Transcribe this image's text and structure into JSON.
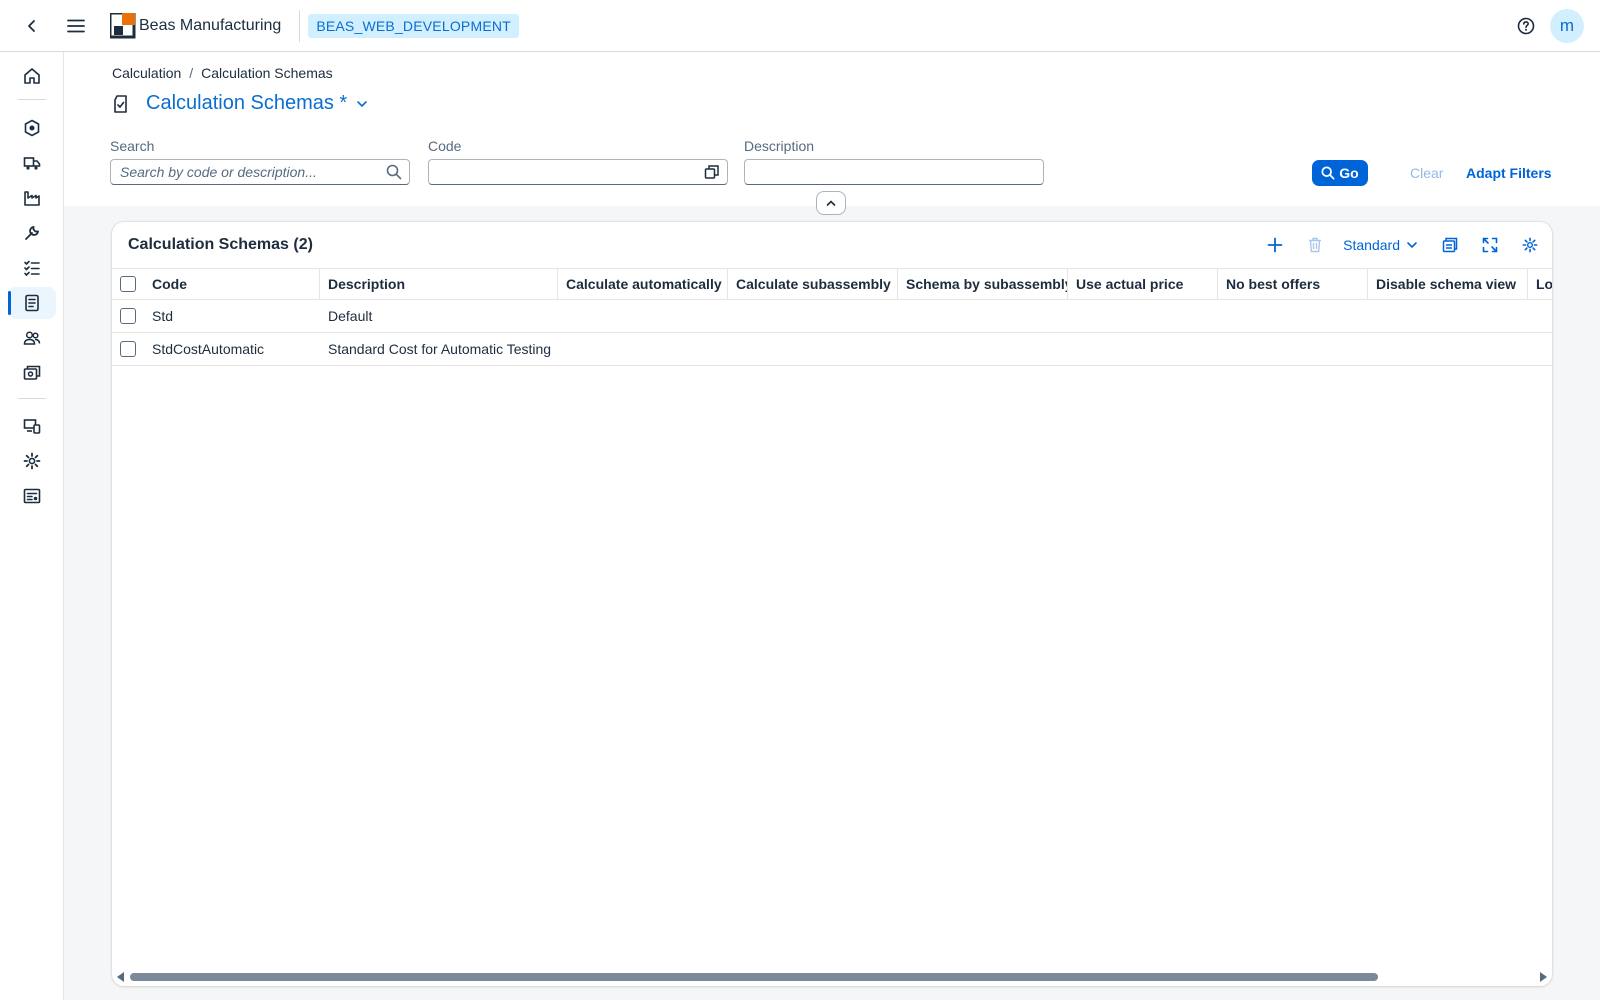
{
  "shell": {
    "app_name": "Beas Manufacturing",
    "system_badge": "BEAS_WEB_DEVELOPMENT",
    "avatar_initial": "m"
  },
  "sidebar": {
    "items": [
      {
        "icon": "home-icon",
        "active": false
      },
      {
        "icon": "products-icon",
        "active": false
      },
      {
        "icon": "delivery-truck-icon",
        "active": false
      },
      {
        "icon": "factory-icon",
        "active": false
      },
      {
        "icon": "wrench-icon",
        "active": false
      },
      {
        "icon": "checklist-icon",
        "active": false
      },
      {
        "icon": "calculation-sheet-icon",
        "active": true
      },
      {
        "icon": "people-icon",
        "active": false
      },
      {
        "icon": "money-cards-icon",
        "active": false
      },
      {
        "icon": "devices-icon",
        "active": false
      },
      {
        "icon": "settings-icon",
        "active": false
      },
      {
        "icon": "report-icon",
        "active": false
      }
    ]
  },
  "breadcrumb": {
    "items": [
      "Calculation",
      "Calculation Schemas"
    ],
    "separator": "/"
  },
  "page": {
    "title": "Calculation Schemas *"
  },
  "filters": {
    "search": {
      "label": "Search",
      "placeholder": "Search by code or description...",
      "value": ""
    },
    "code": {
      "label": "Code",
      "value": ""
    },
    "description": {
      "label": "Description",
      "value": ""
    },
    "go_label": "Go",
    "clear_label": "Clear",
    "adapt_label": "Adapt Filters"
  },
  "table": {
    "title": "Calculation Schemas (2)",
    "variant": "Standard",
    "columns": [
      "Code",
      "Description",
      "Calculate automatically",
      "Calculate subassembly",
      "Schema by subassembly",
      "Use actual price",
      "No best offers",
      "Disable schema view",
      "Lo"
    ],
    "rows": [
      {
        "code": "Std",
        "description": "Default"
      },
      {
        "code": "StdCostAutomatic",
        "description": "Standard Cost for Automatic Testing"
      }
    ]
  },
  "colors": {
    "accent": "#0064d9",
    "title_blue": "#0a6ed1",
    "badge_bg": "#d1efff",
    "logo_orange": "#e8710a"
  }
}
